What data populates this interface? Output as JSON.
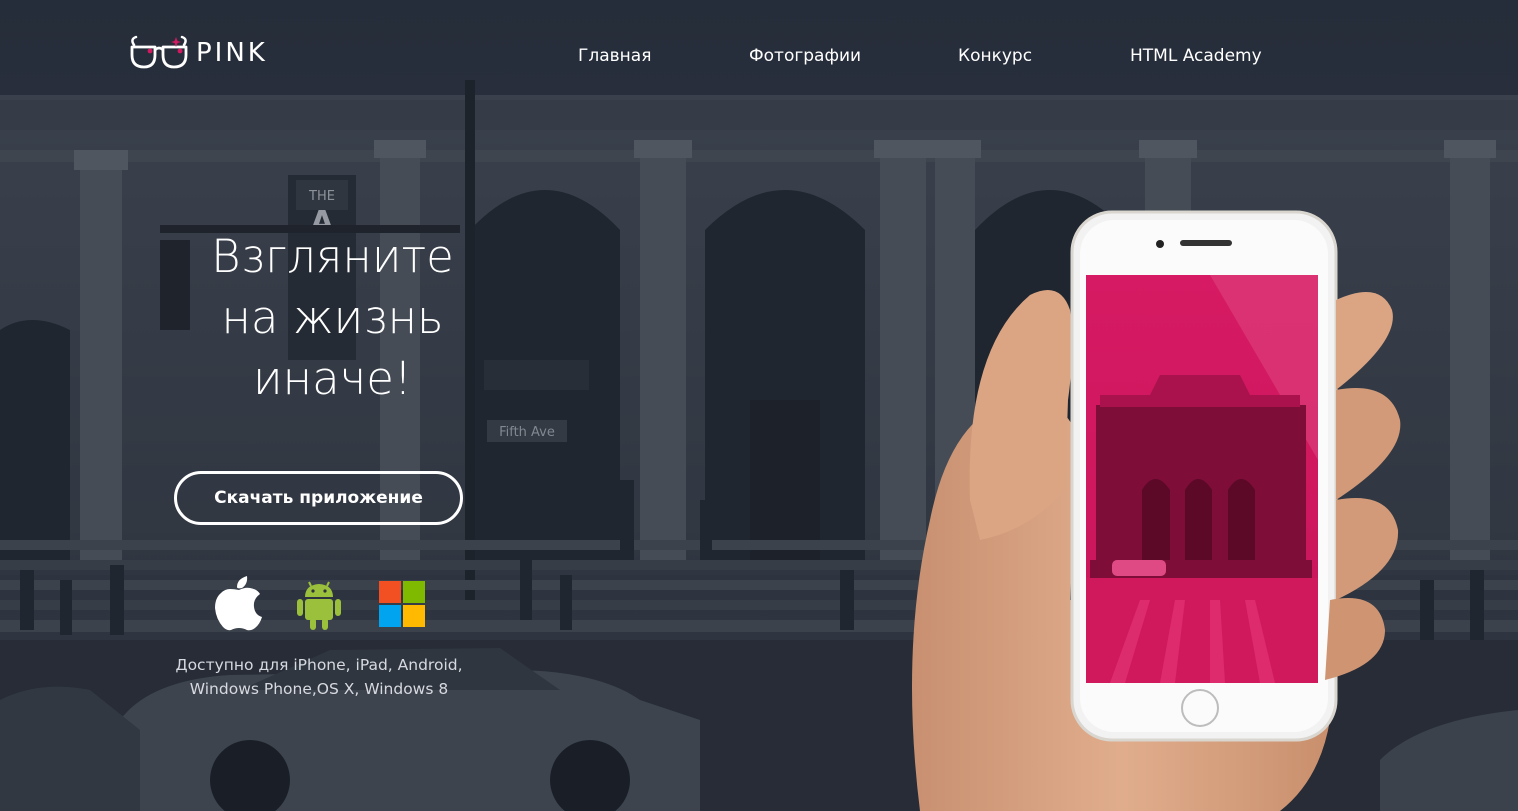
{
  "header": {
    "logo_text": "PINK",
    "nav": [
      {
        "label": "Главная"
      },
      {
        "label": "Фотографии"
      },
      {
        "label": "Конкурс"
      },
      {
        "label": "HTML Academy"
      }
    ]
  },
  "promo": {
    "headline": [
      "Взгляните",
      "на жизнь",
      "иначе!"
    ],
    "download_button": "Скачать приложение",
    "platforms": [
      {
        "name": "apple-icon"
      },
      {
        "name": "android-icon"
      },
      {
        "name": "windows-icon"
      }
    ],
    "availability": [
      "Доступно для iPhone, iPad, Android,",
      "Windows Phone,OS X, Windows 8"
    ]
  },
  "background_texts": {
    "banner_letter": "A",
    "banner_top": "THE",
    "street_sign": "Fifth Ave"
  },
  "colors": {
    "accent_pink": "#d3195f",
    "overlay": "#2a3040",
    "android_green": "#9bc13c",
    "win_red": "#f25022",
    "win_green": "#7fba00",
    "win_blue": "#00a4ef",
    "win_yellow": "#ffb900"
  }
}
